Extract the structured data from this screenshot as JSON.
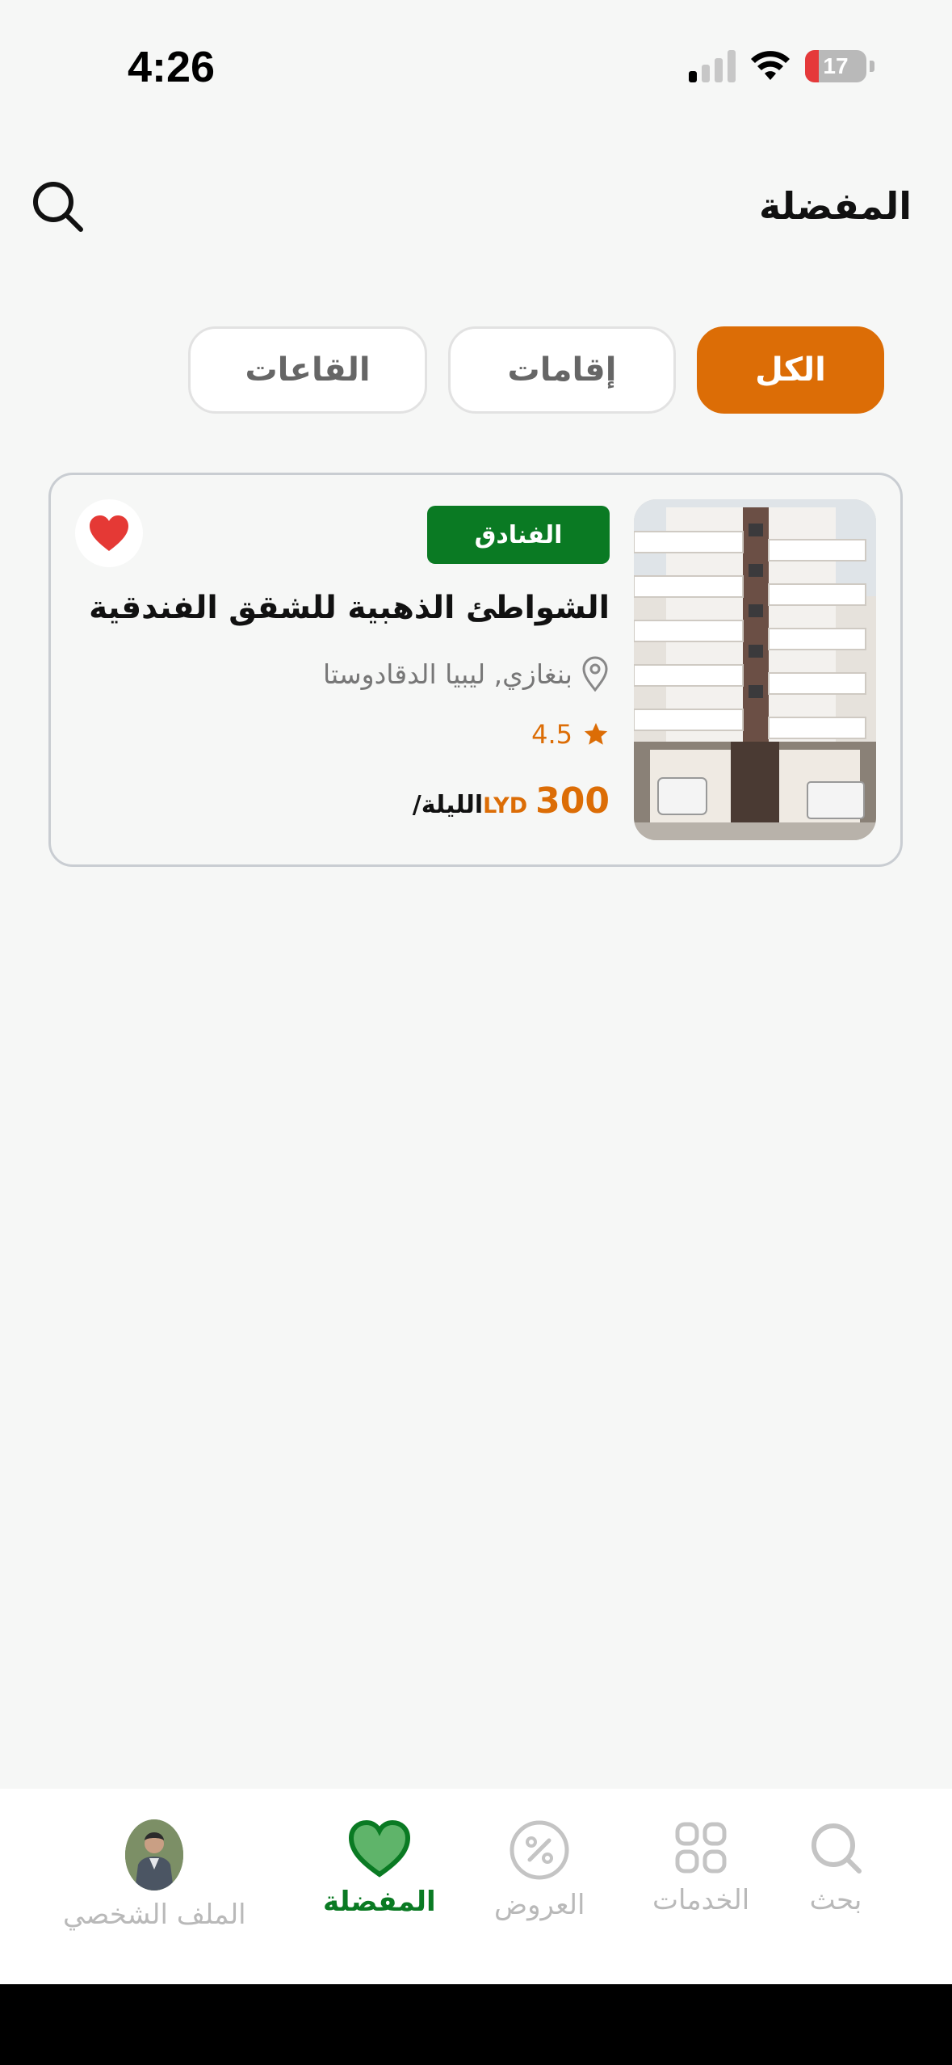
{
  "status_bar": {
    "time": "4:26",
    "battery": "17"
  },
  "header": {
    "title": "المفضلة"
  },
  "tabs": [
    {
      "label": "الكل",
      "active": true
    },
    {
      "label": "إقامات",
      "active": false
    },
    {
      "label": "القاعات",
      "active": false
    }
  ],
  "card": {
    "category": "الفنادق",
    "title": "الشواطئ الذهبية للشقق الفندقية",
    "location": "بنغازي, ليبيا الدقادوستا",
    "rating": "4.5",
    "price": "300",
    "currency": "LYD",
    "per": "/الليلة"
  },
  "bottom_nav": [
    {
      "label": "بحث",
      "icon": "search-icon"
    },
    {
      "label": "الخدمات",
      "icon": "grid-icon"
    },
    {
      "label": "العروض",
      "icon": "percent-icon"
    },
    {
      "label": "المفضلة",
      "icon": "heart-icon",
      "active": true
    },
    {
      "label": "الملف الشخصي",
      "icon": "avatar"
    }
  ],
  "colors": {
    "accent": "#dc6d06",
    "brand_green": "#0a7a23",
    "heart_red": "#e53935"
  }
}
